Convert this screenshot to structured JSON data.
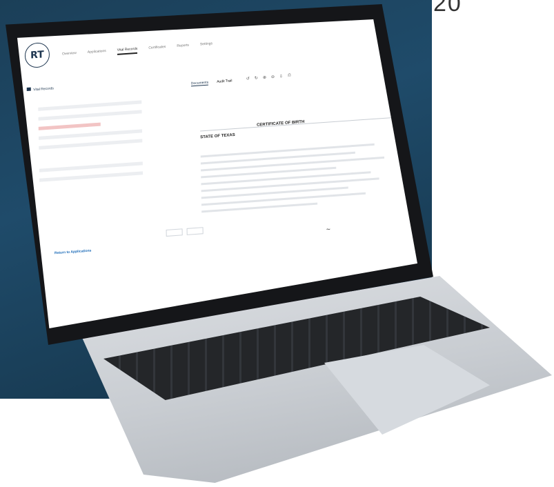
{
  "corner": {
    "text": "20"
  },
  "app": {
    "logo_text": "RT",
    "nav": [
      "Overview",
      "Applications",
      "Vital Records",
      "Certificates",
      "Reports",
      "Settings"
    ],
    "breadcrumb": "Vital Records",
    "tabs": [
      "Documents",
      "Audit Trail"
    ],
    "link_text": "Return to Applications",
    "document": {
      "state": "STATE OF TEXAS",
      "title": "CERTIFICATE OF BIRTH"
    }
  }
}
